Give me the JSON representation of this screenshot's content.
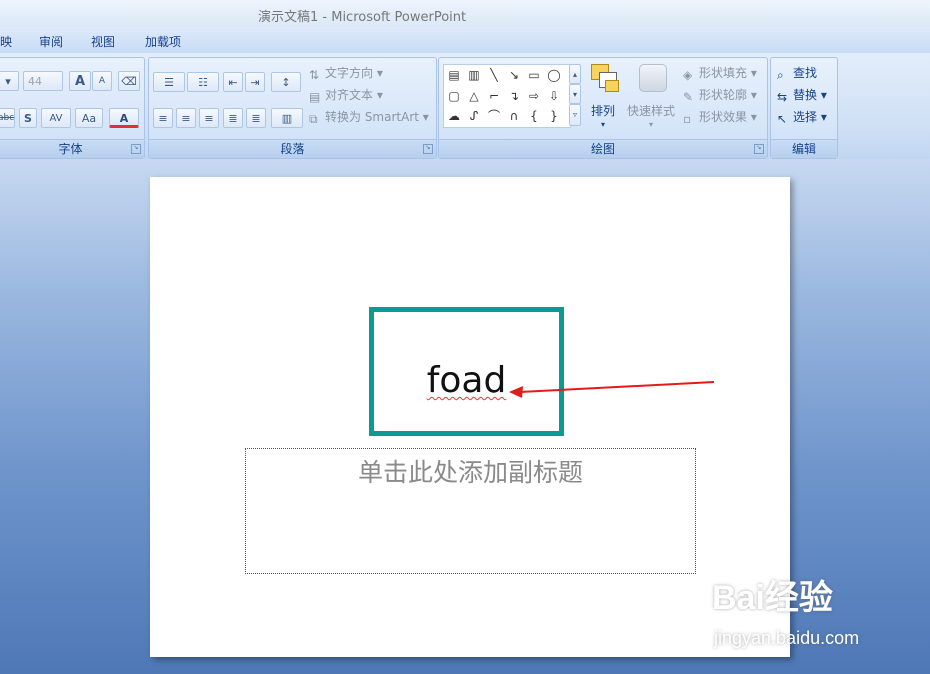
{
  "window": {
    "title": "演示文稿1 - Microsoft PowerPoint"
  },
  "tabs": [
    {
      "label": "映"
    },
    {
      "label": "审阅"
    },
    {
      "label": "视图"
    },
    {
      "label": "加载项"
    }
  ],
  "ribbon": {
    "font_group": {
      "label": "字体",
      "font_size_value": "44",
      "grow_label": "A",
      "shrink_label": "A",
      "strike_label": "abc",
      "shadow_label": "S",
      "spacing_label": "AV",
      "case_label": "Aa",
      "color_label": "A"
    },
    "paragraph_group": {
      "label": "段落",
      "text_direction": "文字方向",
      "align_text": "对齐文本",
      "convert_smartart": "转换为 SmartArt"
    },
    "drawing_group": {
      "label": "绘图",
      "arrange": "排列",
      "quick_styles": "快速样式",
      "shape_fill": "形状填充",
      "shape_outline": "形状轮廓",
      "shape_effects": "形状效果"
    },
    "editing_group": {
      "label": "编辑",
      "find": "查找",
      "replace": "替换",
      "select": "选择"
    }
  },
  "slide": {
    "title_text": "foad",
    "subtitle_placeholder": "单击此处添加副标题"
  },
  "watermark": {
    "brand": "Bai经验",
    "url": "jingyan.baidu.com"
  },
  "colors": {
    "title_border": "#0e9a94",
    "annotation_arrow": "#e21b1b"
  }
}
